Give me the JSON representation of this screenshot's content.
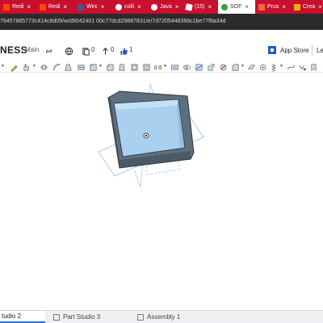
{
  "browser": {
    "tabs": [
      {
        "label": "Redi",
        "favicon_color": "#ff4500",
        "icon": "reddit-icon"
      },
      {
        "label": "Redi",
        "favicon_color": "#ff4500",
        "icon": "reddit-icon"
      },
      {
        "label": "Wirε",
        "favicon_color": "#3b5998",
        "icon": "site-icon"
      },
      {
        "label": "colli",
        "favicon_color": "#ffffff",
        "icon": "google-icon"
      },
      {
        "label": "Java",
        "favicon_color": "#ffffff",
        "icon": "google-icon"
      },
      {
        "label": "(15)",
        "favicon_color": "#ffffff",
        "icon": "roblox-icon"
      },
      {
        "label": "SOF",
        "favicon_color": "#3c9a3c",
        "icon": "onshape-icon",
        "active": true
      },
      {
        "label": "Prus",
        "favicon_color": "#fa6831",
        "icon": "prusa-icon"
      },
      {
        "label": "Crea",
        "favicon_color": "#e8b000",
        "icon": "site-icon"
      }
    ],
    "close_glyph": "×",
    "url": "76457885773c414c8d09/w/d9042401 00c77dcd29887831/e/7d7205448366c1be77f8a34d"
  },
  "titlebar": {
    "doc_title": "NESS",
    "branch": "Main",
    "versions_count": "0",
    "comments_count": "0",
    "likes_count": "1",
    "app_store": "App Store",
    "learn": "Le"
  },
  "toolbar": {
    "tools": [
      "sketch-icon",
      "extrude-icon",
      "revolve-icon",
      "sweep-icon",
      "loft-icon",
      "thicken-icon",
      "fillet-icon",
      "chamfer-icon",
      "draft-icon",
      "shell-icon",
      "hole-icon",
      "linear-pattern-icon",
      "circular-pattern-icon",
      "mirror-icon",
      "boolean-icon",
      "split-icon",
      "transform-icon",
      "delete-part-icon",
      "modify-fillet-icon",
      "plane-icon",
      "mate-connector-icon",
      "helix-icon",
      "curve-icon",
      "variable-icon",
      "custom-feature-icon",
      "more-icon"
    ]
  },
  "model": {
    "body_color": "#5f6f7d",
    "interior_color": "#a9d0ee",
    "plane_color": "#7aa7d8"
  },
  "bottom_tabs": [
    {
      "label": "tudio 2",
      "active": true
    },
    {
      "label": "Part Studio 3",
      "active": false
    },
    {
      "label": "Assembly 1",
      "active": false
    }
  ]
}
